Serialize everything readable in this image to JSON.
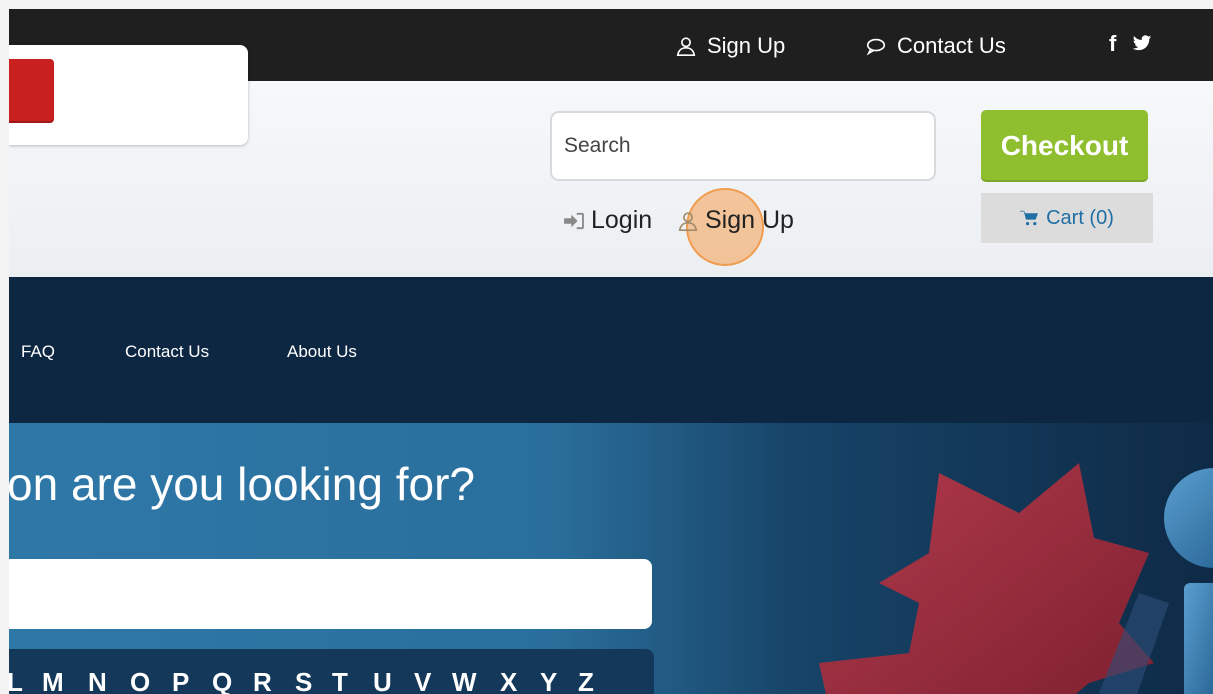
{
  "topbar": {
    "signup_label": "Sign Up",
    "contact_label": "Contact Us",
    "facebook": "f",
    "twitter_icon": "twitter-icon"
  },
  "header": {
    "search_placeholder": "Search",
    "checkout_label": "Checkout",
    "login_label": "Login",
    "signup_label": "Sign Up",
    "cart_label": "Cart (0)"
  },
  "nav": {
    "items": [
      {
        "label": "FAQ"
      },
      {
        "label": "Contact Us"
      },
      {
        "label": "About Us"
      }
    ]
  },
  "hero": {
    "title": "on are you looking for?",
    "letters": [
      "L",
      "M",
      "N",
      "O",
      "P",
      "Q",
      "R",
      "S",
      "T",
      "U",
      "V",
      "W",
      "X",
      "Y",
      "Z"
    ]
  },
  "colors": {
    "topbar": "#1f1f1f",
    "checkout": "#8fbe2f",
    "nav": "#0d2742",
    "accent_red": "#c8201f",
    "cart_text": "#1f6fa5"
  }
}
